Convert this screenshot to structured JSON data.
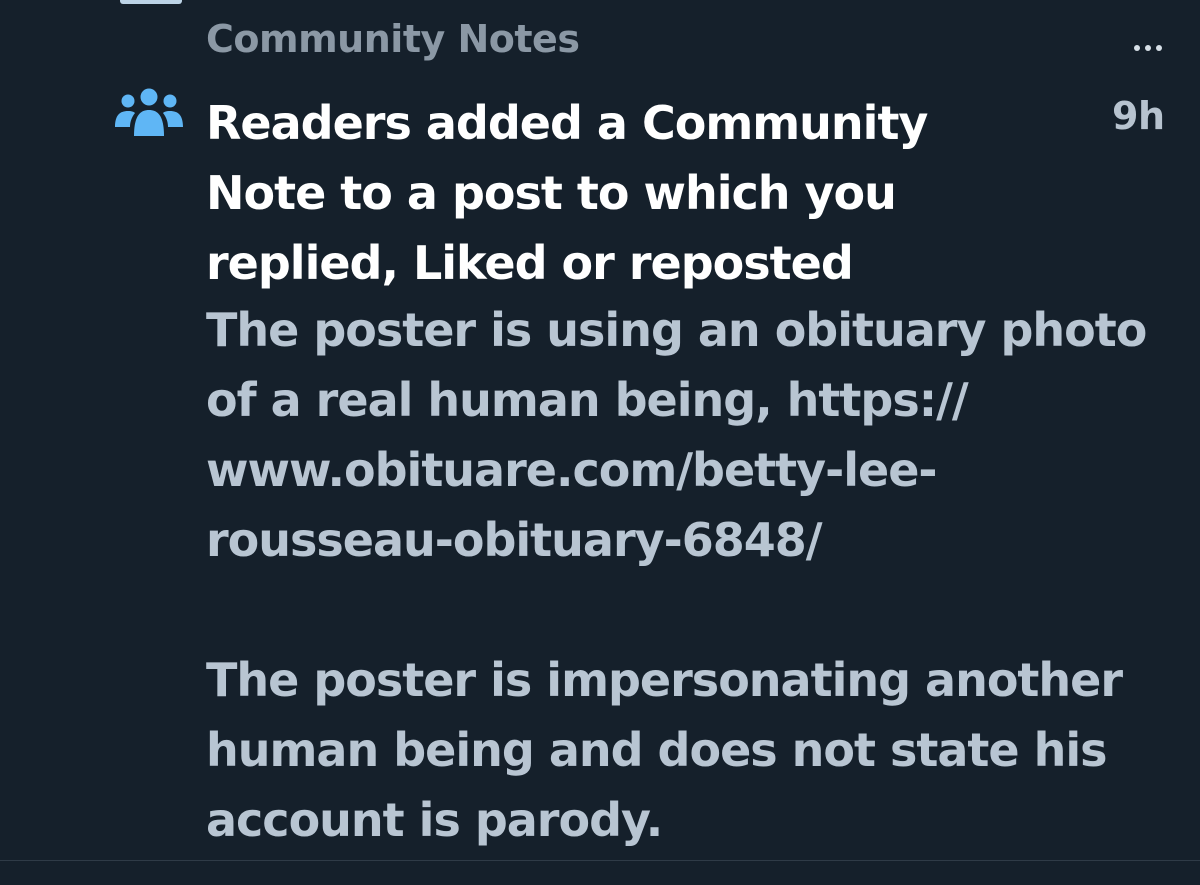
{
  "notification": {
    "section_title": "Community Notes",
    "icon": "people-group-icon",
    "headline_lines": [
      "Readers added a Community",
      "Note to a post to which you",
      "replied, Liked or reposted"
    ],
    "timestamp": "9h",
    "note_lines": [
      "The poster is using an obituary photo",
      "of a real human being, https://",
      "www.obituare.com/betty-lee-",
      "rousseau-obituary-6848/",
      "",
      "The poster is impersonating another",
      "human being and does not state his",
      "account is parody."
    ]
  },
  "colors": {
    "background": "#15202b",
    "headline": "#ffffff",
    "note_text": "#b8c5d2",
    "section_title": "#8b98a5",
    "icon": "#1d9bf0"
  }
}
